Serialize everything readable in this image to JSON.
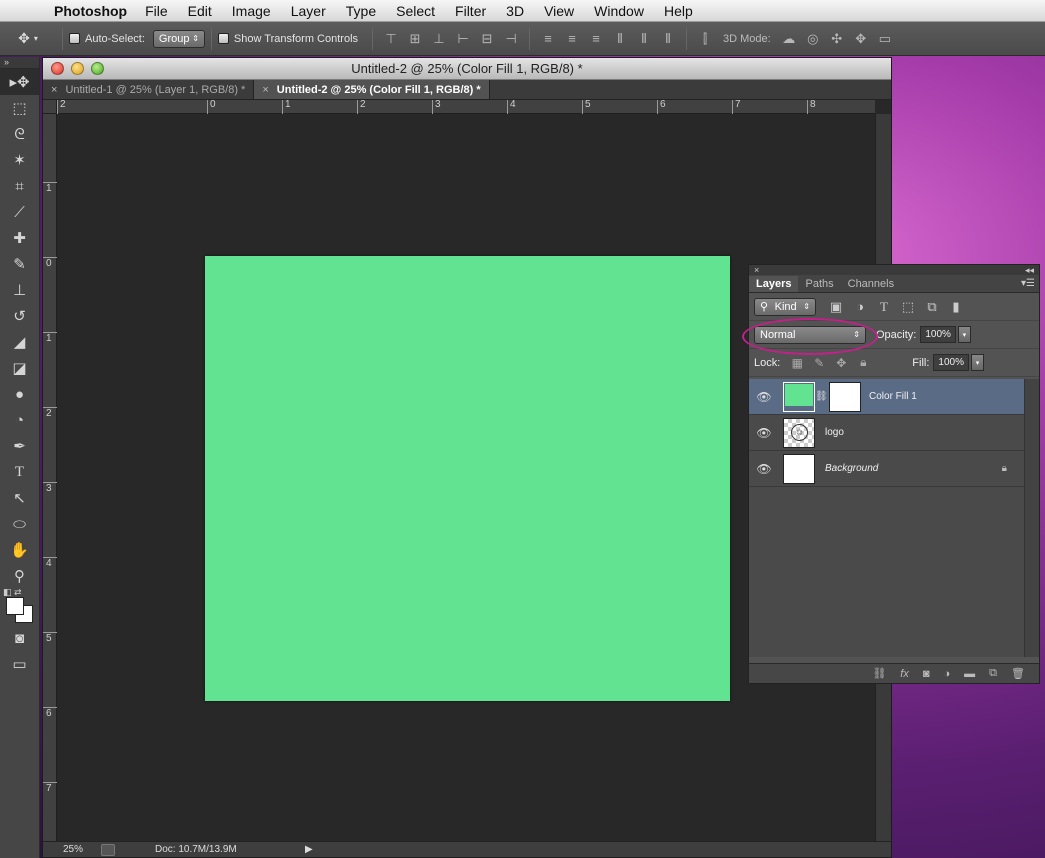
{
  "menubar": {
    "apple_glyph": "",
    "app_name": "Photoshop",
    "items": [
      "File",
      "Edit",
      "Image",
      "Layer",
      "Type",
      "Select",
      "Filter",
      "3D",
      "View",
      "Window",
      "Help"
    ]
  },
  "options": {
    "auto_select_label": "Auto-Select:",
    "auto_select_value": "Group",
    "transform_label": "Show Transform Controls",
    "mode_label": "3D Mode:"
  },
  "document": {
    "title": "Untitled-2 @ 25% (Color Fill 1, RGB/8) *",
    "tabs": [
      {
        "label": "Untitled-1 @ 25% (Layer 1, RGB/8) *"
      },
      {
        "label": "Untitled-2 @ 25% (Color Fill 1, RGB/8) *"
      }
    ],
    "ruler_h": [
      "2",
      "0",
      "1",
      "2",
      "3",
      "4",
      "5",
      "6",
      "7",
      "8"
    ],
    "ruler_v": [
      "1",
      "0",
      "1",
      "2",
      "3",
      "4",
      "5",
      "6",
      "7"
    ],
    "canvas_color": "#62e391",
    "status": {
      "zoom": "25%",
      "doc": "Doc: 10.7M/13.9M"
    }
  },
  "layers_panel": {
    "tabs": [
      "Layers",
      "Paths",
      "Channels"
    ],
    "filter_kind": "Kind",
    "blend_mode": "Normal",
    "opacity_label": "Opacity:",
    "opacity_value": "100%",
    "lock_label": "Lock:",
    "fill_label": "Fill:",
    "fill_value": "100%",
    "layers": [
      {
        "name": "Color Fill 1",
        "selected": true
      },
      {
        "name": "logo",
        "selected": false
      },
      {
        "name": "Background",
        "selected": false
      }
    ]
  },
  "colors": {
    "highlight": "#c2218a",
    "selected_layer": "#5a6b85"
  }
}
